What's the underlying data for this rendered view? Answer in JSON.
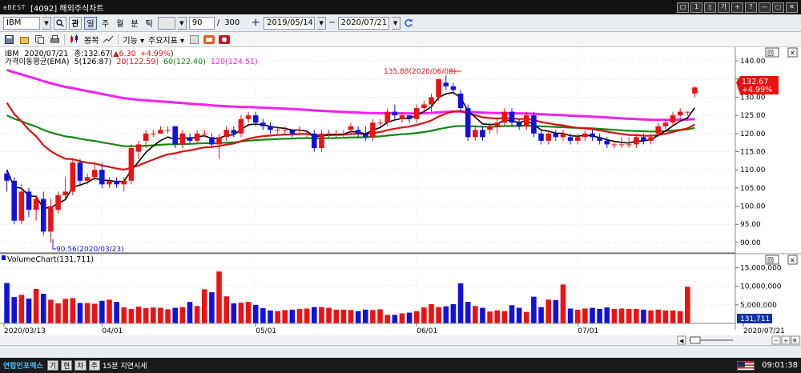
{
  "window": {
    "logo": "eBEST",
    "title": "[4092] 해외주식차트",
    "buttons": [
      "▢",
      "1",
      "▯",
      "가",
      "+",
      "?",
      "—",
      "▢",
      "✕"
    ]
  },
  "toolbar": {
    "symbol": "IBM",
    "search_icon": "search-icon",
    "lock_label": "관",
    "period_tabs": [
      "일",
      "주",
      "월",
      "분",
      "틱"
    ],
    "active_period": "일",
    "interval_value": "",
    "count_value": "90",
    "count_sep": "/",
    "count_total": "300",
    "plus_label": "+",
    "date_from": "2019/05/14",
    "date_tilde": "~",
    "date_to": "2020/07/21",
    "refresh_icon": "refresh-icon"
  },
  "toolbar2": {
    "mode_label": "봉복",
    "func_label": "기능",
    "indicator_label": "주요지표"
  },
  "chart": {
    "price_header": {
      "symbol": "IBM",
      "date": "2020/07/21",
      "close_label": "종:132.67(",
      "change": "▲6.30",
      "change_pct": "+4.99%",
      "close_paren": ")"
    },
    "ma_header": {
      "title": "가격이동평균(EMA)",
      "ma5": "5(126.87)",
      "ma20": "20(122.59)",
      "ma60": "60(122.40)",
      "ma120": "120(124.51)"
    },
    "high_annotation": "135.88(2020/06/08)",
    "low_annotation": "90.56(2020/03/23)",
    "price_ticks": [
      "140.00",
      "135.00",
      "130.00",
      "125.00",
      "120.00",
      "115.00",
      "110.00",
      "105.00",
      "100.00",
      "95.00",
      "90.00"
    ],
    "price_current": "132.67",
    "price_current_pct": "+4.99%",
    "volume_title": "VolumeChart(131,711)",
    "volume_ticks": [
      "15,000,000",
      "10,000,000",
      "5,000,000"
    ],
    "volume_current": "131,711",
    "date_labels": [
      "2020/03/13",
      "04/01",
      "05/01",
      "06/01",
      "07/01",
      "2020/07/21"
    ],
    "colors": {
      "up": "#ee1111",
      "down": "#1111dd",
      "ma5": "#000000",
      "ma20": "#dd1111",
      "ma60": "#118811",
      "ma120": "#ee22ee"
    }
  },
  "chart_data": {
    "type": "candlestick",
    "symbol": "IBM",
    "ylim": [
      88,
      142
    ],
    "volume_ylim": [
      0,
      17500000
    ],
    "candles": [
      [
        109,
        110,
        104,
        107,
        10900000
      ],
      [
        107,
        108,
        95,
        96,
        7100000
      ],
      [
        96,
        106,
        95,
        104,
        7700000
      ],
      [
        104,
        105,
        97,
        99,
        6700000
      ],
      [
        99,
        103,
        96,
        102,
        9300000
      ],
      [
        102,
        104,
        92,
        93,
        8000000
      ],
      [
        93,
        102,
        90,
        100,
        6400000
      ],
      [
        99,
        104,
        98,
        103,
        5400000
      ],
      [
        103,
        108,
        102,
        104,
        6600000
      ],
      [
        104,
        113,
        103,
        112,
        6800000
      ],
      [
        112,
        113,
        106,
        107,
        5500000
      ],
      [
        107,
        109,
        106,
        108,
        5500000
      ],
      [
        108,
        112,
        107,
        110,
        5300000
      ],
      [
        110,
        112,
        105,
        106,
        6100000
      ],
      [
        106,
        108,
        105,
        107,
        6400000
      ],
      [
        107,
        108,
        105,
        106,
        5800000
      ],
      [
        106,
        108,
        104,
        107,
        4300000
      ],
      [
        107,
        117,
        106,
        116,
        3900000
      ],
      [
        115,
        118,
        113,
        117,
        4500000
      ],
      [
        118,
        121,
        116,
        120,
        4100000
      ],
      [
        120,
        121,
        119,
        120,
        4300000
      ],
      [
        120,
        122,
        120,
        121,
        4200000
      ],
      [
        121,
        122,
        120,
        121,
        3800000
      ],
      [
        122,
        122,
        116,
        117,
        4200000
      ],
      [
        117,
        121,
        116,
        120,
        4400000
      ],
      [
        119,
        120,
        117,
        118,
        5800000
      ],
      [
        118,
        121,
        117,
        120,
        4700000
      ],
      [
        120,
        121,
        119,
        120,
        9200000
      ],
      [
        119,
        120,
        116,
        117,
        8400000
      ],
      [
        117,
        120,
        113,
        119,
        14000000
      ],
      [
        119,
        122,
        118,
        121,
        7300000
      ],
      [
        121,
        122,
        119,
        120,
        5400000
      ],
      [
        120,
        125,
        119,
        124,
        5600000
      ],
      [
        124,
        126,
        123,
        125,
        5800000
      ],
      [
        125,
        126,
        122,
        123,
        5000000
      ],
      [
        123,
        124,
        121,
        122,
        4100000
      ],
      [
        122,
        123,
        120,
        121,
        3500000
      ],
      [
        121,
        122,
        120,
        121,
        3300000
      ],
      [
        121,
        122,
        120,
        121,
        3600000
      ],
      [
        121,
        121,
        119,
        120,
        3700000
      ],
      [
        121,
        122,
        120,
        121,
        3900000
      ],
      [
        120,
        121,
        119,
        120,
        4000000
      ],
      [
        120,
        121,
        115,
        116,
        4400000
      ],
      [
        116,
        121,
        115,
        120,
        4400000
      ],
      [
        120,
        121,
        119,
        120,
        4200000
      ],
      [
        120,
        121,
        119,
        120,
        3700000
      ],
      [
        120,
        121,
        119,
        120,
        3700000
      ],
      [
        121,
        123,
        120,
        122,
        3600000
      ],
      [
        121,
        122,
        119,
        120,
        3300000
      ],
      [
        120,
        122,
        118,
        119,
        3700000
      ],
      [
        119,
        124,
        118,
        123,
        3600000
      ],
      [
        123,
        124,
        122,
        123,
        3800000
      ],
      [
        123,
        127,
        122,
        126,
        2300000
      ],
      [
        126,
        128,
        124,
        125,
        2300000
      ],
      [
        124,
        126,
        123,
        125,
        2700000
      ],
      [
        125,
        125,
        123,
        124,
        2900000
      ],
      [
        124,
        128,
        123,
        127,
        3300000
      ],
      [
        127,
        129,
        126,
        128,
        4300000
      ],
      [
        128,
        131,
        126,
        130,
        5200000
      ],
      [
        130,
        135,
        129,
        135,
        4400000
      ],
      [
        134,
        136,
        132,
        133,
        4600000
      ],
      [
        133,
        134,
        131,
        132,
        5200000
      ],
      [
        131,
        132,
        126,
        127,
        10800000
      ],
      [
        127,
        128,
        118,
        119,
        5800000
      ],
      [
        119,
        122,
        118,
        121,
        4700000
      ],
      [
        121,
        122,
        118,
        119,
        4200000
      ],
      [
        121,
        123,
        120,
        122,
        3200000
      ],
      [
        122,
        124,
        120,
        123,
        3500000
      ],
      [
        123,
        127,
        122,
        126,
        3300000
      ],
      [
        126,
        127,
        122,
        123,
        4900000
      ],
      [
        123,
        124,
        121,
        122,
        4200000
      ],
      [
        122,
        126,
        121,
        125,
        3100000
      ],
      [
        125,
        126,
        119,
        120,
        7200000
      ],
      [
        120,
        121,
        117,
        118,
        4400000
      ],
      [
        118,
        121,
        117,
        120,
        6400000
      ],
      [
        120,
        121,
        118,
        119,
        6300000
      ],
      [
        119,
        121,
        118,
        120,
        10500000
      ],
      [
        119,
        120,
        117,
        118,
        4000000
      ],
      [
        118,
        120,
        117,
        119,
        3700000
      ],
      [
        119,
        121,
        118,
        120,
        4000000
      ],
      [
        120,
        121,
        118,
        119,
        4200000
      ],
      [
        119,
        120,
        117,
        118,
        3900000
      ],
      [
        118,
        119,
        116,
        117,
        4300000
      ],
      [
        117,
        118,
        116,
        117,
        3900000
      ],
      [
        117,
        119,
        116,
        117,
        4000000
      ],
      [
        117,
        119,
        116,
        117,
        3900000
      ],
      [
        117,
        120,
        116,
        119,
        3900000
      ],
      [
        119,
        120,
        117,
        118,
        3700000
      ],
      [
        118,
        120,
        117,
        119,
        3500000
      ],
      [
        120,
        123,
        119,
        122,
        3700000
      ],
      [
        122,
        124,
        121,
        123,
        3500000
      ],
      [
        123,
        126,
        122,
        125,
        3500000
      ],
      [
        125,
        127,
        124,
        126,
        3300000
      ],
      [
        126,
        126,
        125,
        126,
        9900000
      ],
      [
        131,
        133,
        130,
        132.67,
        131711
      ]
    ],
    "ma5_last": 126.87,
    "ma20_last": 122.59,
    "ma60_last": 122.4,
    "ma120_last": 124.51,
    "high": {
      "value": 135.88,
      "date": "2020/06/08"
    },
    "low": {
      "value": 90.56,
      "date": "2020/03/23"
    }
  },
  "statusbar": {
    "buttons": [
      "◀",
      "▶",
      "⟲"
    ]
  },
  "bottombar": {
    "brand": "연합인포맥스",
    "btn1": "기",
    "btn2": "현",
    "btn3": "차",
    "btn4": "주",
    "delay_text": "15분 지연시세",
    "clock": "09:01:38"
  }
}
